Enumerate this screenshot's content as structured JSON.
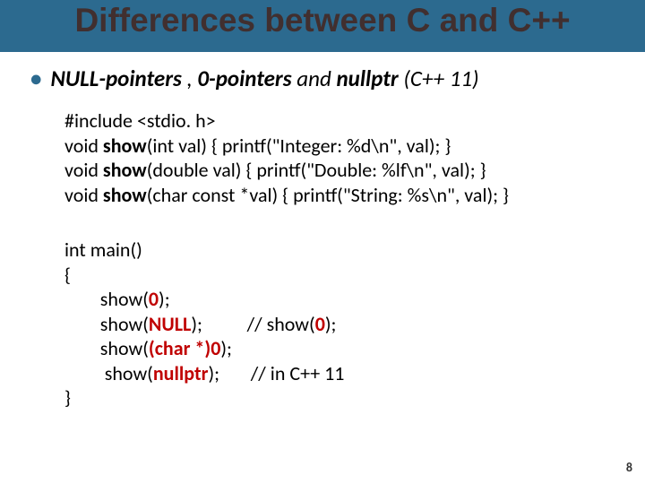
{
  "slide": {
    "title": "Differences between C and C++",
    "page_number": "8"
  },
  "bullet": {
    "np": "NULL-pointers",
    "sep1": " , ",
    "zp": "0-pointers",
    "and": " and ",
    "nullptr": "nullptr",
    "tail": " (C++ 11)"
  },
  "code1": {
    "l1a": "#include <stdio. h>",
    "l2a": "void ",
    "l2b": "show",
    "l2c": "(int val) { printf(\"Integer: %d\\n\", val); }",
    "l3a": "void ",
    "l3b": "show",
    "l3c": "(double val) { printf(\"Double: %lf\\n\", val); }",
    "l4a": "void ",
    "l4b": "show",
    "l4c": "(char const *val) { printf(\"String: %s\\n\", val); }"
  },
  "code2": {
    "l1": "int main()",
    "l2": "{",
    "l3a": "        show(",
    "l3b": "0",
    "l3c": ");",
    "l4a": "        show(",
    "l4b": "NULL",
    "l4c": ");          // show(",
    "l4d": "0",
    "l4e": ");",
    "l5a": "        show(",
    "l5b": "(char *)0",
    "l5c": ");",
    "l6a": "         show(",
    "l6b": "nullptr",
    "l6c": ");       // in C++ 11",
    "l7": "}"
  }
}
